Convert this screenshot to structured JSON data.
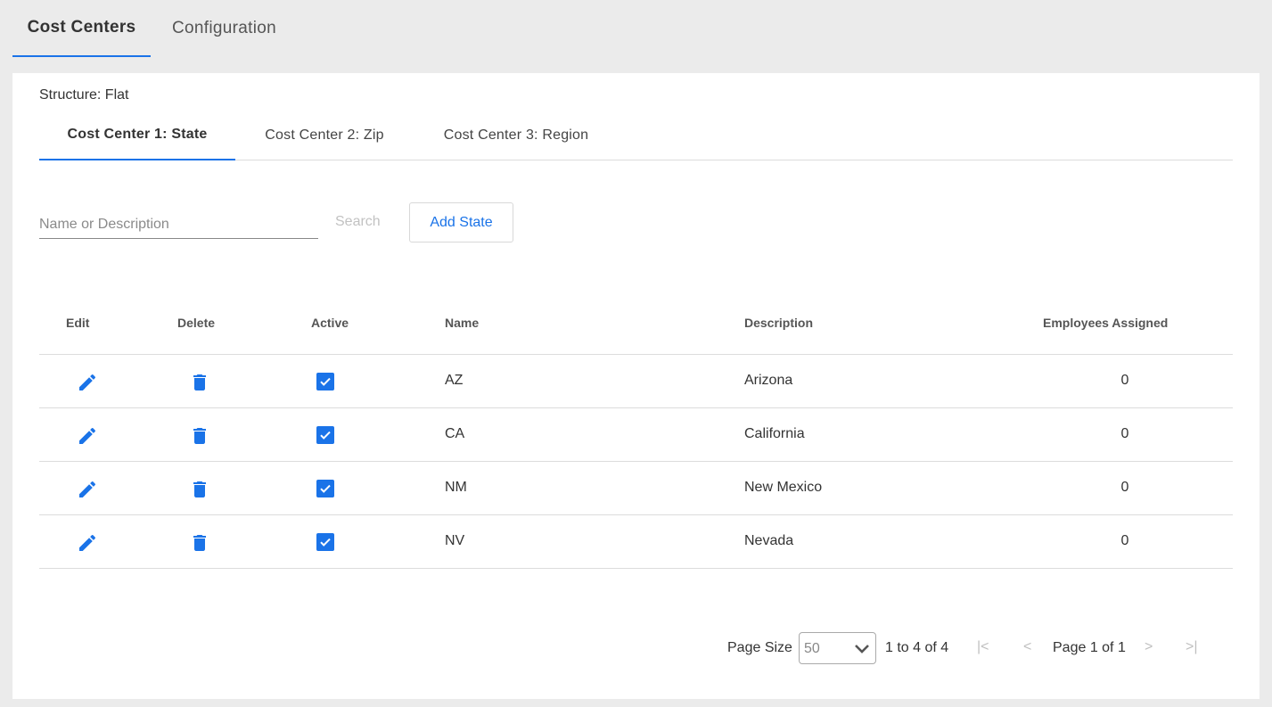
{
  "top_tabs": [
    "Cost Centers",
    "Configuration"
  ],
  "structure_label": "Structure: Flat",
  "cc_tabs": [
    "Cost Center 1: State",
    "Cost Center 2: Zip",
    "Cost Center 3: Region"
  ],
  "search": {
    "placeholder": "Name or Description",
    "button": "Search"
  },
  "add_button": "Add State",
  "columns": [
    "Edit",
    "Delete",
    "Active",
    "Name",
    "Description",
    "Employees Assigned"
  ],
  "rows": [
    {
      "name": "AZ",
      "description": "Arizona",
      "employees": "0"
    },
    {
      "name": "CA",
      "description": "California",
      "employees": "0"
    },
    {
      "name": "NM",
      "description": "New Mexico",
      "employees": "0"
    },
    {
      "name": "NV",
      "description": "Nevada",
      "employees": "0"
    }
  ],
  "pager": {
    "page_size_label": "Page Size",
    "page_size": "50",
    "range": "1 to 4 of 4",
    "first": "|<",
    "prev": "<",
    "page_text": "Page 1 of 1",
    "next": ">",
    "last": ">|"
  },
  "icons": [
    "pencil-icon",
    "trash-icon",
    "checkbox-checked-icon",
    "chevron-down-icon"
  ],
  "colors": {
    "accent": "#1a73e8",
    "background": "#ebebeb",
    "panel": "#ffffff"
  }
}
